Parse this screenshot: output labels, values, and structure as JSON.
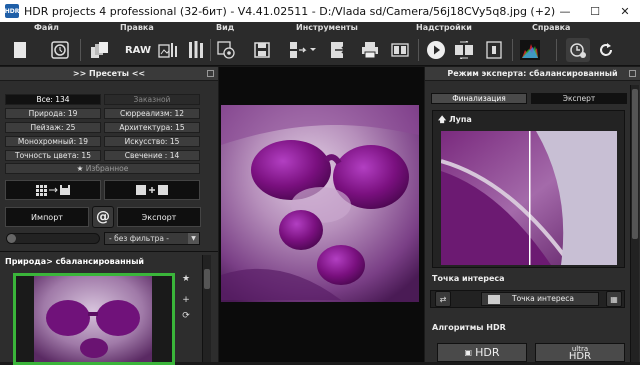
{
  "window": {
    "title": "HDR projects 4 professional (32-бит) - V4.41.02511 - D:/Vlada sd/Camera/56j18CVy5q8.jpg (+2)",
    "app_icon_text": "HDR",
    "controls": [
      "—",
      "☐",
      "✕"
    ]
  },
  "menu": [
    "Файл",
    "Правка",
    "Вид",
    "Инструменты",
    "Надстройки",
    "Справка"
  ],
  "toolbar": {
    "raw_label": "RAW"
  },
  "left_panel": {
    "header": ">> Пресеты <<",
    "presets": {
      "all": "Все: 134",
      "custom": "Заказной",
      "nature": "Природа: 19",
      "surreal": "Сюрреализм: 12",
      "landscape": "Пейзаж: 25",
      "architecture": "Архитектура: 15",
      "mono": "Монохромный: 19",
      "art": "Искусство: 15",
      "color_accuracy": "Точность цвета: 15",
      "glow": "Свечение : 14",
      "favorites": "Избранное"
    },
    "import_label": "Импорт",
    "export_label": "Экспорт",
    "at_symbol": "@",
    "filter_value": "- без фильтра -",
    "preset_title": "Природа> сбалансированный"
  },
  "right_panel": {
    "header": "Режим эксперта: сбалансированный",
    "tab_finalize": "Финализация",
    "tab_expert": "Эксперт",
    "loupe_label": "Лупа",
    "poi_section": "Точка интереса",
    "poi_button": "Точка интереса",
    "hdr_section": "Алгоритмы HDR",
    "hdr_button": "HDR",
    "ultra_hdr_top": "ultra",
    "ultra_hdr_bottom": "HDR"
  },
  "colors": {
    "accent_green": "#3ab53a",
    "photo_purple": "#8a2a8a"
  }
}
